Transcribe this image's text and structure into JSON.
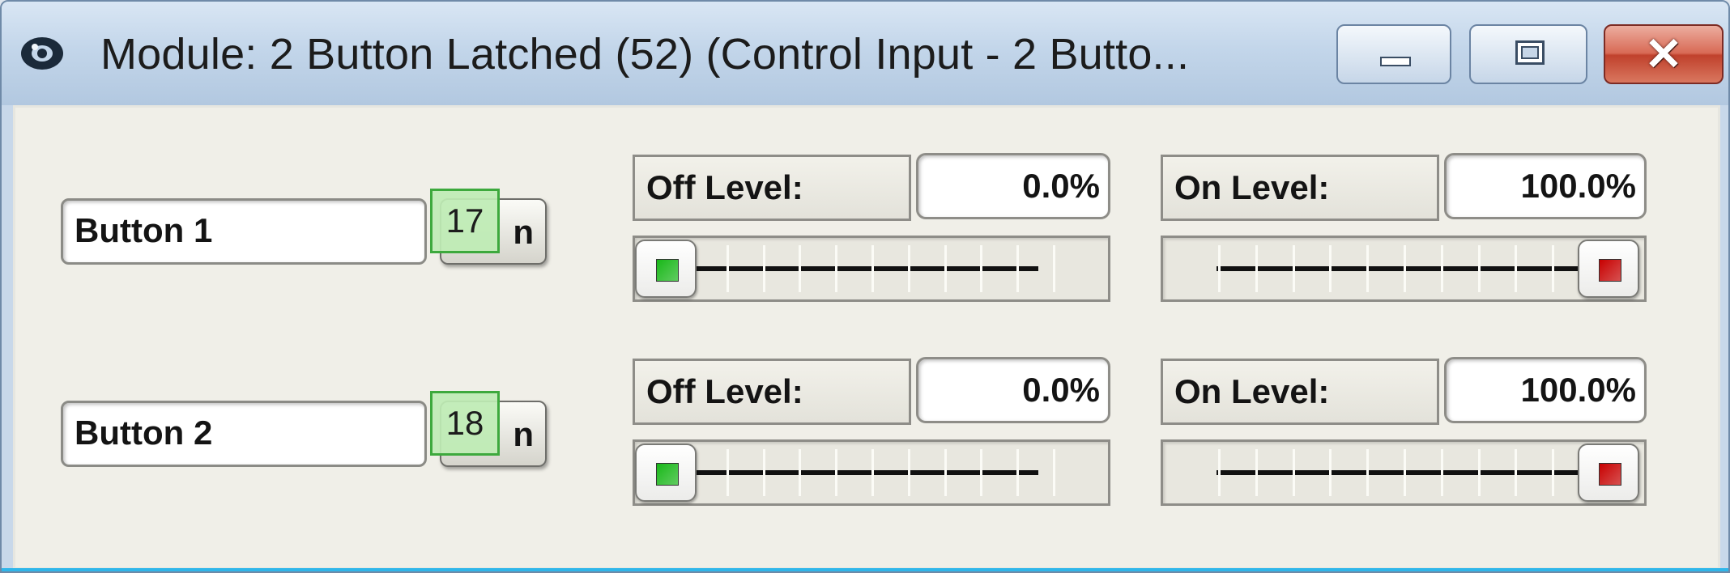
{
  "window": {
    "title": "Module: 2 Button Latched (52) (Control Input - 2 Butto...",
    "controls": {
      "minimize": "minimize",
      "maximize": "maximize",
      "close": "close"
    }
  },
  "buttons": [
    {
      "name": "Button 1",
      "mode_label": "n",
      "badge": "17",
      "off_label": "Off Level:",
      "off_value": "0.0%",
      "on_label": "On Level:",
      "on_value": "100.0%",
      "off_slider_level": 0.0,
      "on_slider_level": 1.0
    },
    {
      "name": "Button 2",
      "mode_label": "n",
      "badge": "18",
      "off_label": "Off Level:",
      "off_value": "0.0%",
      "on_label": "On Level:",
      "on_value": "100.0%",
      "off_slider_level": 0.0,
      "on_slider_level": 1.0
    }
  ],
  "colors": {
    "off_led": "#18b818",
    "on_led": "#c80000",
    "badge_border": "#3da93d"
  }
}
